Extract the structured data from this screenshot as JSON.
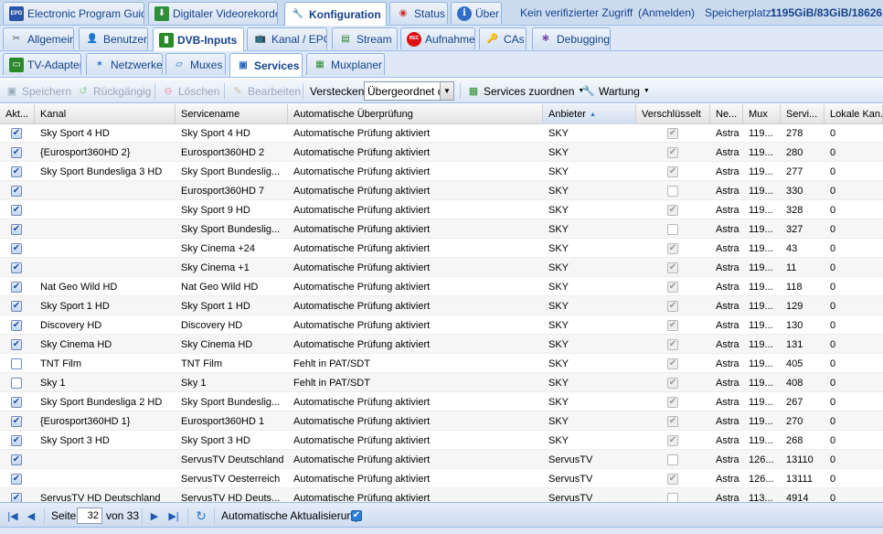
{
  "top_tabs": [
    {
      "label": "Electronic Program Guide",
      "icon": "epg-icon",
      "glyph": "EPG",
      "active": false
    },
    {
      "label": "Digitaler Videorekorder",
      "icon": "download-icon",
      "glyph": "⬇",
      "active": false
    },
    {
      "label": "Konfiguration",
      "icon": "wrench-icon",
      "glyph": "🔧",
      "active": true
    },
    {
      "label": "Status",
      "icon": "eye-icon",
      "glyph": "◉",
      "active": false
    },
    {
      "label": "Über",
      "icon": "info-icon",
      "glyph": "i",
      "active": false
    }
  ],
  "header_info": {
    "access": "Kein verifizierter Zugriff",
    "login": "(Anmelden)",
    "storage_label": "Speicherplatz:",
    "storage_value": "1195GiB/83GiB/18626"
  },
  "config_tabs": [
    {
      "label": "Allgemein",
      "icon": "tools-icon",
      "glyph": "✂",
      "active": false
    },
    {
      "label": "Benutzer",
      "icon": "user-icon",
      "glyph": "👤",
      "active": false
    },
    {
      "label": "DVB-Inputs",
      "icon": "dvb-card-icon",
      "glyph": "▮",
      "active": true
    },
    {
      "label": "Kanal / EPG",
      "icon": "tv-icon",
      "glyph": "📺",
      "active": false
    },
    {
      "label": "Stream",
      "icon": "stream-icon",
      "glyph": "▤",
      "active": false
    },
    {
      "label": "Aufnahme",
      "icon": "rec-icon",
      "glyph": "REC",
      "active": false
    },
    {
      "label": "CAs",
      "icon": "key-icon",
      "glyph": "🔑",
      "active": false
    },
    {
      "label": "Debugging",
      "icon": "bug-icon",
      "glyph": "✱",
      "active": false
    }
  ],
  "dvb_tabs": [
    {
      "label": "TV-Adapter",
      "icon": "adapter-icon",
      "glyph": "▭",
      "active": false
    },
    {
      "label": "Netzwerke",
      "icon": "antenna-icon",
      "glyph": "✶",
      "active": false
    },
    {
      "label": "Muxes",
      "icon": "mux-icon",
      "glyph": "▱",
      "active": false
    },
    {
      "label": "Services",
      "icon": "services-icon",
      "glyph": "▣",
      "active": true
    },
    {
      "label": "Muxplaner",
      "icon": "planner-icon",
      "glyph": "▦",
      "active": false
    }
  ],
  "toolbar": {
    "save": "Speichern",
    "undo": "Rückgängig",
    "delete": "Löschen",
    "edit": "Bearbeiten",
    "hide_label": "Verstecken:",
    "hide_value": "Übergeordnet d",
    "map_services": "Services zuordnen",
    "maintenance": "Wartung"
  },
  "columns": [
    "Akt...",
    "Kanal",
    "Servicename",
    "Automatische Überprüfung",
    "Anbieter",
    "Verschlüsselt",
    "Ne...",
    "Mux",
    "Servi...",
    "Lokale Kan..."
  ],
  "rows": [
    {
      "enabled": true,
      "channel": "Sky Sport 4 HD",
      "service": "Sky Sport 4 HD",
      "check": "Automatische Prüfung aktiviert",
      "provider": "SKY",
      "encrypted": true,
      "network": "Astra",
      "mux": "119...",
      "sid": "278",
      "local": "0"
    },
    {
      "enabled": true,
      "channel": "{Eurosport360HD 2}",
      "service": "Eurosport360HD 2",
      "check": "Automatische Prüfung aktiviert",
      "provider": "SKY",
      "encrypted": true,
      "network": "Astra",
      "mux": "119...",
      "sid": "280",
      "local": "0"
    },
    {
      "enabled": true,
      "channel": "Sky Sport Bundesliga 3 HD",
      "service": "Sky Sport Bundeslig...",
      "check": "Automatische Prüfung aktiviert",
      "provider": "SKY",
      "encrypted": true,
      "network": "Astra",
      "mux": "119...",
      "sid": "277",
      "local": "0"
    },
    {
      "enabled": true,
      "channel": "",
      "service": "Eurosport360HD 7",
      "check": "Automatische Prüfung aktiviert",
      "provider": "SKY",
      "encrypted": false,
      "network": "Astra",
      "mux": "119...",
      "sid": "330",
      "local": "0"
    },
    {
      "enabled": true,
      "channel": "",
      "service": "Sky Sport 9 HD",
      "check": "Automatische Prüfung aktiviert",
      "provider": "SKY",
      "encrypted": true,
      "network": "Astra",
      "mux": "119...",
      "sid": "328",
      "local": "0"
    },
    {
      "enabled": true,
      "channel": "",
      "service": "Sky Sport Bundeslig...",
      "check": "Automatische Prüfung aktiviert",
      "provider": "SKY",
      "encrypted": false,
      "network": "Astra",
      "mux": "119...",
      "sid": "327",
      "local": "0"
    },
    {
      "enabled": true,
      "channel": "",
      "service": "Sky Cinema +24",
      "check": "Automatische Prüfung aktiviert",
      "provider": "SKY",
      "encrypted": true,
      "network": "Astra",
      "mux": "119...",
      "sid": "43",
      "local": "0"
    },
    {
      "enabled": true,
      "channel": "",
      "service": "Sky Cinema +1",
      "check": "Automatische Prüfung aktiviert",
      "provider": "SKY",
      "encrypted": true,
      "network": "Astra",
      "mux": "119...",
      "sid": "11",
      "local": "0"
    },
    {
      "enabled": true,
      "channel": "Nat Geo Wild HD",
      "service": "Nat Geo Wild HD",
      "check": "Automatische Prüfung aktiviert",
      "provider": "SKY",
      "encrypted": true,
      "network": "Astra",
      "mux": "119...",
      "sid": "118",
      "local": "0"
    },
    {
      "enabled": true,
      "channel": "Sky Sport 1 HD",
      "service": "Sky Sport 1 HD",
      "check": "Automatische Prüfung aktiviert",
      "provider": "SKY",
      "encrypted": true,
      "network": "Astra",
      "mux": "119...",
      "sid": "129",
      "local": "0"
    },
    {
      "enabled": true,
      "channel": "Discovery HD",
      "service": "Discovery HD",
      "check": "Automatische Prüfung aktiviert",
      "provider": "SKY",
      "encrypted": true,
      "network": "Astra",
      "mux": "119...",
      "sid": "130",
      "local": "0"
    },
    {
      "enabled": true,
      "channel": "Sky Cinema HD",
      "service": "Sky Cinema HD",
      "check": "Automatische Prüfung aktiviert",
      "provider": "SKY",
      "encrypted": true,
      "network": "Astra",
      "mux": "119...",
      "sid": "131",
      "local": "0"
    },
    {
      "enabled": false,
      "channel": "TNT Film",
      "service": "TNT Film",
      "check": "Fehlt in PAT/SDT",
      "provider": "SKY",
      "encrypted": true,
      "network": "Astra",
      "mux": "119...",
      "sid": "405",
      "local": "0"
    },
    {
      "enabled": false,
      "channel": "Sky 1",
      "service": "Sky 1",
      "check": "Fehlt in PAT/SDT",
      "provider": "SKY",
      "encrypted": true,
      "network": "Astra",
      "mux": "119...",
      "sid": "408",
      "local": "0"
    },
    {
      "enabled": true,
      "channel": "Sky Sport Bundesliga 2 HD",
      "service": "Sky Sport Bundeslig...",
      "check": "Automatische Prüfung aktiviert",
      "provider": "SKY",
      "encrypted": true,
      "network": "Astra",
      "mux": "119...",
      "sid": "267",
      "local": "0"
    },
    {
      "enabled": true,
      "channel": "{Eurosport360HD 1}",
      "service": "Eurosport360HD 1",
      "check": "Automatische Prüfung aktiviert",
      "provider": "SKY",
      "encrypted": true,
      "network": "Astra",
      "mux": "119...",
      "sid": "270",
      "local": "0"
    },
    {
      "enabled": true,
      "channel": "Sky Sport 3 HD",
      "service": "Sky Sport 3 HD",
      "check": "Automatische Prüfung aktiviert",
      "provider": "SKY",
      "encrypted": true,
      "network": "Astra",
      "mux": "119...",
      "sid": "268",
      "local": "0"
    },
    {
      "enabled": true,
      "channel": "",
      "service": "ServusTV Deutschland",
      "check": "Automatische Prüfung aktiviert",
      "provider": "ServusTV",
      "encrypted": false,
      "network": "Astra",
      "mux": "126...",
      "sid": "13110",
      "local": "0"
    },
    {
      "enabled": true,
      "channel": "",
      "service": "ServusTV Oesterreich",
      "check": "Automatische Prüfung aktiviert",
      "provider": "ServusTV",
      "encrypted": true,
      "network": "Astra",
      "mux": "126...",
      "sid": "13111",
      "local": "0"
    },
    {
      "enabled": true,
      "channel": "ServusTV HD Deutschland",
      "service": "ServusTV HD Deuts...",
      "check": "Automatische Prüfung aktiviert",
      "provider": "ServusTV",
      "encrypted": false,
      "network": "Astra",
      "mux": "113...",
      "sid": "4914",
      "local": "0"
    }
  ],
  "pager": {
    "page_label": "Seite",
    "page": "32",
    "of_label": "von 33",
    "auto_refresh": "Automatische Aktualisierung",
    "auto_refresh_checked": true
  },
  "colors": {
    "accent": "#15428b",
    "tab_bg": "#dfe8f6",
    "border": "#99bbe8"
  }
}
